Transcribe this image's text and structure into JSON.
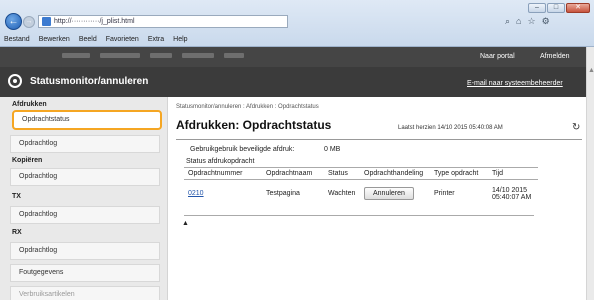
{
  "browser": {
    "address_text": "http://············/j_plist.html",
    "menu": [
      "Bestand",
      "Bewerken",
      "Beeld",
      "Favorieten",
      "Extra",
      "Help"
    ],
    "search_glyph": "⌕",
    "tool_glyphs": [
      "⌂",
      "☆",
      "⚙"
    ],
    "back_glyph": "←",
    "fwd_glyph": "→",
    "win_min": "–",
    "win_max": "□",
    "win_close": "✕"
  },
  "header": {
    "portal_link": "Naar portal",
    "logout_link": "Afmelden",
    "title": "Statusmonitor/annuleren",
    "admin_email": "E-mail naar systeembeheerder"
  },
  "sidebar": {
    "sections": [
      {
        "heading": "Afdrukken",
        "items": [
          "Opdrachtstatus",
          "Opdrachtlog"
        ]
      },
      {
        "heading": "Kopiëren",
        "items": [
          "Opdrachtlog"
        ]
      },
      {
        "heading": "TX",
        "items": [
          "Opdrachtlog"
        ]
      },
      {
        "heading": "RX",
        "items": [
          "Opdrachtlog",
          "Foutgegevens",
          "Verbruiksartikelen"
        ]
      }
    ]
  },
  "main": {
    "breadcrumb": "Statusmonitor/annuleren : Afdrukken : Opdrachtstatus",
    "title": "Afdrukken: Opdrachtstatus",
    "last_updated": "Laatst herzien 14/10 2015 05:40:08 AM",
    "refresh_glyph": "↻",
    "usage_label": "Gebruikgebruik beveiligde afdruk:",
    "usage_value": "0 MB",
    "section_label": "Status afdrukopdracht",
    "table": {
      "headers": [
        "Opdrachtnummer",
        "Opdrachtnaam",
        "Status",
        "Opdrachthandeling",
        "Type opdracht",
        "Tijd"
      ],
      "rows": [
        {
          "id": "0210",
          "name": "Testpagina",
          "status": "Wachten",
          "action": "Annuleren",
          "type": "Printer",
          "time_line1": "14/10 2015",
          "time_line2": "05:40:07 AM"
        }
      ]
    },
    "top_glyph": "▲"
  }
}
